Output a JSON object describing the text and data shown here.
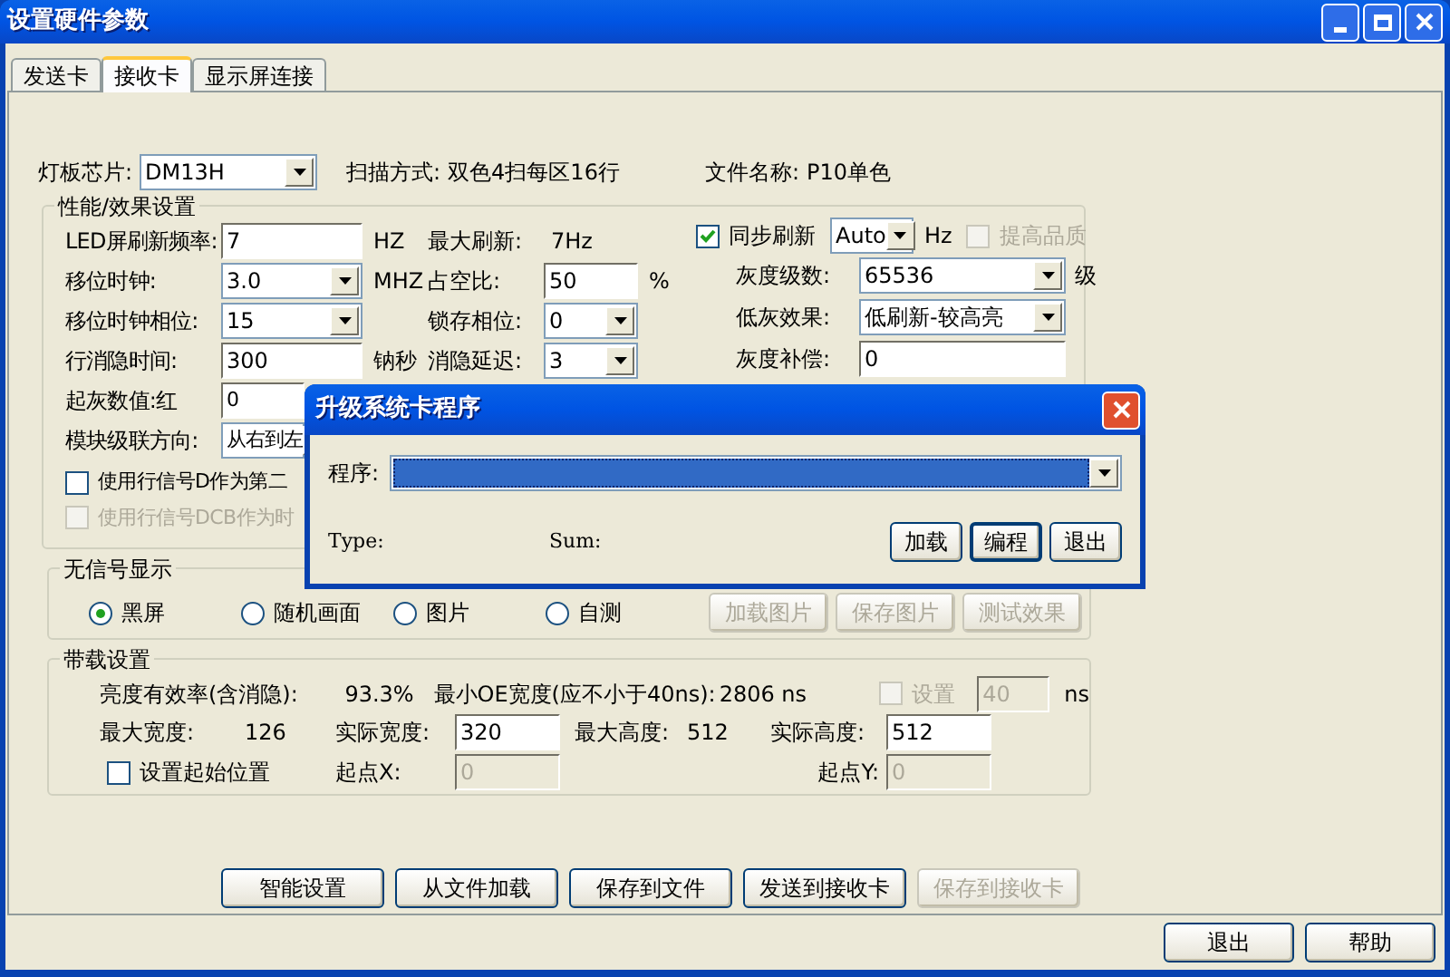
{
  "window": {
    "title": "设置硬件参数"
  },
  "tabs": [
    {
      "label": "发送卡",
      "selected": false
    },
    {
      "label": "接收卡",
      "selected": true
    },
    {
      "label": "显示屏连接",
      "selected": false
    }
  ],
  "header": [
    {
      "label": "灯板芯片:",
      "kind": "select",
      "value": "DM13H"
    },
    {
      "label": "扫描方式:",
      "kind": "text",
      "value": "双色4扫每区16行"
    },
    {
      "label": "文件名称:",
      "kind": "text",
      "value": "P10单色"
    }
  ],
  "performance": {
    "title": "性能/效果设置",
    "rows": [
      {
        "label": "LED屏刷新频率:",
        "field": {
          "kind": "input",
          "value": "7"
        },
        "unit": "HZ",
        "label2": "最大刷新:",
        "field2": {
          "kind": "text",
          "value": "7Hz"
        }
      },
      {
        "label": "移位时钟:",
        "field": {
          "kind": "select",
          "value": "3.0"
        },
        "unit": "MHZ",
        "label2": "占空比:",
        "field2": {
          "kind": "input",
          "value": "50"
        },
        "unit2": "%"
      },
      {
        "label": "移位时钟相位:",
        "field": {
          "kind": "select",
          "value": "15"
        },
        "label2": "锁存相位:",
        "field2": {
          "kind": "select",
          "value": "0"
        }
      },
      {
        "label": "行消隐时间:",
        "field": {
          "kind": "input",
          "value": "300"
        },
        "unit": "钠秒",
        "label2": "消隐延迟:",
        "field2": {
          "kind": "select",
          "value": "3"
        }
      },
      {
        "label": "起灰数值:红",
        "field": {
          "kind": "input",
          "value": "0"
        }
      },
      {
        "label": "模块级联方向:",
        "field": {
          "kind": "select",
          "value": "从右到左"
        }
      }
    ],
    "checks": [
      {
        "label": "使用行信号D作为第二",
        "checked": false,
        "disabled": false
      },
      {
        "label": "使用行信号DCB作为时",
        "checked": false,
        "disabled": true
      }
    ],
    "sync": {
      "label": "同步刷新",
      "checked": true,
      "value": "Auto",
      "unit": "Hz"
    },
    "quality": {
      "label": "提高品质",
      "checked": false,
      "disabled": true
    },
    "right_rows": [
      {
        "label": "灰度级数:",
        "kind": "select",
        "value": "65536",
        "unit": "级"
      },
      {
        "label": "低灰效果:",
        "kind": "select",
        "value": "低刷新-较高亮"
      },
      {
        "label": "灰度补偿:",
        "kind": "input",
        "value": "0"
      }
    ]
  },
  "no_signal": {
    "title": "无信号显示",
    "options": [
      {
        "label": "黑屏",
        "selected": true
      },
      {
        "label": "随机画面",
        "selected": false
      },
      {
        "label": "图片",
        "selected": false
      },
      {
        "label": "自测",
        "selected": false
      }
    ],
    "buttons": [
      {
        "label": "加载图片",
        "disabled": true
      },
      {
        "label": "保存图片",
        "disabled": true
      },
      {
        "label": "测试效果",
        "disabled": true
      }
    ]
  },
  "load": {
    "title": "带载设置",
    "efficiency": {
      "label": "亮度有效率(含消隐):",
      "value": "93.3%"
    },
    "min_oe": {
      "label": "最小OE宽度(应不小于40ns):",
      "value": "2806 ns"
    },
    "set": {
      "label": "设置",
      "checked": false,
      "disabled": true,
      "value": "40",
      "unit": "ns"
    },
    "max_width": {
      "label": "最大宽度:",
      "value": "126"
    },
    "actual_width": {
      "label": "实际宽度:",
      "value": "320"
    },
    "max_height": {
      "label": "最大高度:",
      "value": "512"
    },
    "actual_height": {
      "label": "实际高度:",
      "value": "512"
    },
    "start": {
      "label": "设置起始位置",
      "checked": false
    },
    "start_x": {
      "label": "起点X:",
      "value": "0",
      "disabled": true
    },
    "start_y": {
      "label": "起点Y:",
      "value": "0",
      "disabled": true
    }
  },
  "actions": [
    {
      "label": "智能设置",
      "disabled": false
    },
    {
      "label": "从文件加载",
      "disabled": false
    },
    {
      "label": "保存到文件",
      "disabled": false
    },
    {
      "label": "发送到接收卡",
      "disabled": false
    },
    {
      "label": "保存到接收卡",
      "disabled": true
    }
  ],
  "footer_buttons": [
    "退出",
    "帮助"
  ],
  "dialog": {
    "title": "升级系统卡程序",
    "field_label": "程序:",
    "type_label": "Type:",
    "sum_label": "Sum:",
    "buttons": [
      {
        "label": "加载",
        "default": false
      },
      {
        "label": "编程",
        "default": true
      },
      {
        "label": "退出",
        "default": false
      }
    ]
  }
}
